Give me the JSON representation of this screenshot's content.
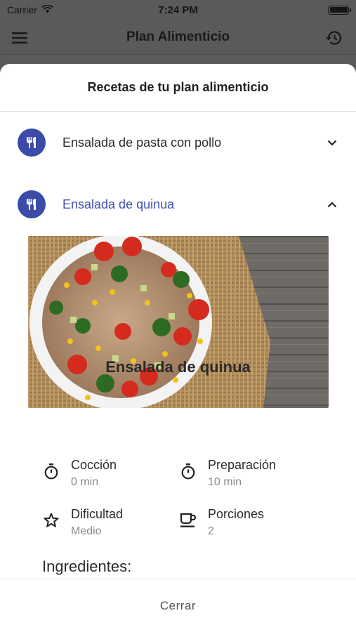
{
  "status_bar": {
    "carrier": "Carrier",
    "time": "7:24 PM",
    "battery_level": 1.0
  },
  "app_header": {
    "title": "Plan Alimenticio",
    "menu_icon": "hamburger-menu-icon",
    "history_icon": "history-icon"
  },
  "sheet": {
    "title": "Recetas de tu plan alimenticio",
    "recipes": [
      {
        "label": "Ensalada de pasta con pollo",
        "icon": "fork-knife-icon",
        "expanded": false
      },
      {
        "label": "Ensalada de quinua",
        "icon": "fork-knife-icon",
        "expanded": true
      }
    ],
    "detail": {
      "title": "Ensalada de quinua",
      "stats": {
        "coccion": {
          "label": "Cocción",
          "value": "0 min",
          "icon": "timer-icon"
        },
        "preparacion": {
          "label": "Preparación",
          "value": "10 min",
          "icon": "timer-icon"
        },
        "dificultad": {
          "label": "Dificultad",
          "value": "Medio",
          "icon": "star-icon"
        },
        "porciones": {
          "label": "Porciones",
          "value": "2",
          "icon": "cup-icon"
        }
      },
      "ingredients_heading": "Ingredientes:"
    },
    "close_label": "Cerrar"
  },
  "colors": {
    "accent": "#3f51b5",
    "icon_bg": "#3b4ba8",
    "overlay": "#5a5a5a"
  }
}
